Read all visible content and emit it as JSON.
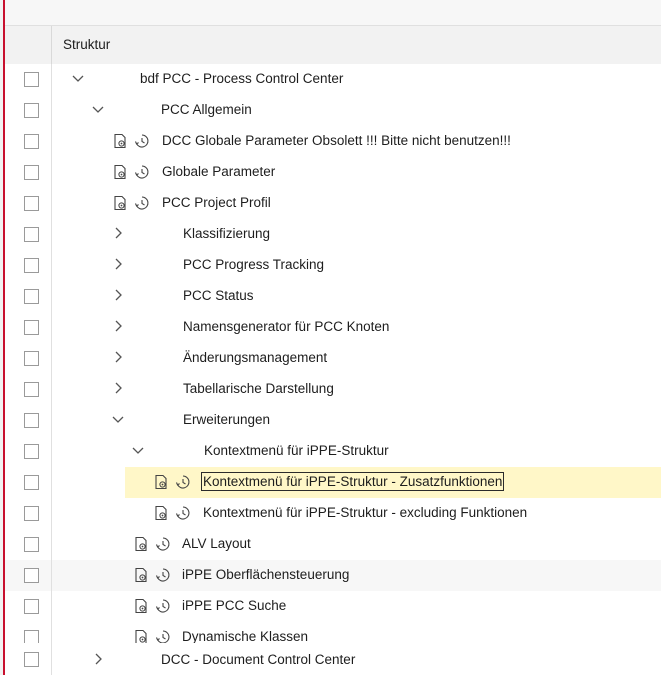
{
  "header": {
    "title": "Struktur"
  },
  "rows": [
    {
      "label": "bdf PCC - Process Control Center",
      "expander": "expanded",
      "icons": false
    },
    {
      "label": "PCC Allgemein",
      "expander": "expanded",
      "icons": false
    },
    {
      "label": "DCC Globale Parameter  Obsolett !!! Bitte nicht benutzen!!!",
      "expander": "none",
      "icons": true
    },
    {
      "label": "Globale Parameter",
      "expander": "none",
      "icons": true
    },
    {
      "label": "PCC Project Profil",
      "expander": "none",
      "icons": true
    },
    {
      "label": "Klassifizierung",
      "expander": "collapsed",
      "icons": false
    },
    {
      "label": "PCC Progress Tracking",
      "expander": "collapsed",
      "icons": false
    },
    {
      "label": "PCC Status",
      "expander": "collapsed",
      "icons": false
    },
    {
      "label": "Namensgenerator für PCC Knoten",
      "expander": "collapsed",
      "icons": false
    },
    {
      "label": "Änderungsmanagement",
      "expander": "collapsed",
      "icons": false
    },
    {
      "label": "Tabellarische Darstellung",
      "expander": "collapsed",
      "icons": false
    },
    {
      "label": "Erweiterungen",
      "expander": "expanded",
      "icons": false
    },
    {
      "label": "Kontextmenü für iPPE-Struktur",
      "expander": "expanded",
      "icons": false
    },
    {
      "label": "Kontextmenü für iPPE-Struktur - Zusatzfunktionen",
      "expander": "none",
      "icons": true,
      "selected": true
    },
    {
      "label": "Kontextmenü für iPPE-Struktur - excluding Funktionen",
      "expander": "none",
      "icons": true
    },
    {
      "label": "ALV Layout",
      "expander": "none",
      "icons": true
    },
    {
      "label": "iPPE Oberflächensteuerung",
      "expander": "none",
      "icons": true
    },
    {
      "label": "iPPE PCC Suche",
      "expander": "none",
      "icons": true
    },
    {
      "label": "Dynamische Klassen",
      "expander": "none",
      "icons": true
    },
    {
      "label": "DCC - Document Control Center",
      "expander": "collapsed",
      "icons": false
    }
  ],
  "colors": {
    "accent_border": "#c8102e",
    "selected_row": "#fff7c8"
  },
  "icon_names": {
    "node_icon": "settings-document-icon",
    "history_icon": "clock-history-icon",
    "expanded": "chevron-down-icon",
    "collapsed": "chevron-right-icon"
  }
}
